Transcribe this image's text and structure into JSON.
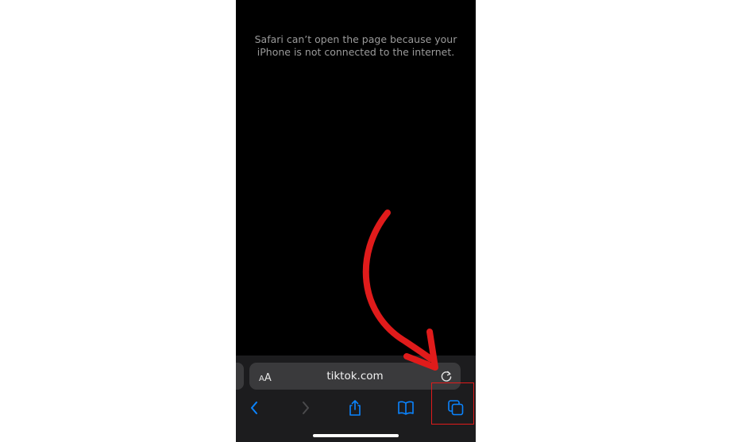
{
  "browser": {
    "error_message": "Safari can’t open the page because your iPhone is not connected to the internet.",
    "address_bar": {
      "text_size_button": {
        "small": "A",
        "big": "A"
      },
      "url": "tiktok.com"
    },
    "toolbar_icons": [
      "back-icon",
      "forward-icon",
      "share-icon",
      "bookmarks-icon",
      "tabs-icon"
    ]
  },
  "colors": {
    "background": "#000000",
    "toolbar": "#1c1c1e",
    "accent": "#0a84ff",
    "annotation": "#e01b1b"
  }
}
